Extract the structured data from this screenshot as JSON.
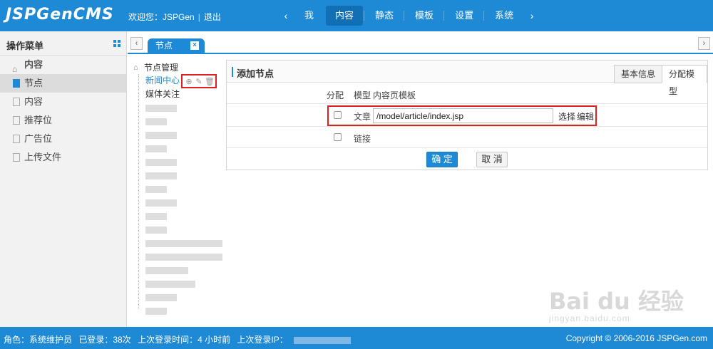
{
  "app": {
    "logo": "JSPGenCMS"
  },
  "header": {
    "welcome": "欢迎您：JSPGen",
    "logout": "退出",
    "nav_prev": "‹",
    "nav": [
      "我",
      "内容",
      "静态",
      "模板",
      "设置",
      "系统"
    ],
    "nav_active": "内容",
    "nav_next": "›"
  },
  "sidebar": {
    "title": "操作菜单",
    "group": "内容",
    "items": [
      "节点",
      "内容",
      "推荐位",
      "广告位",
      "上传文件"
    ],
    "selected": "节点"
  },
  "tabs": {
    "active": "节点",
    "close": "×",
    "scroll_left": "‹",
    "scroll_right": "›"
  },
  "tree": {
    "root": "节点管理",
    "nodes": [
      {
        "label": "新闻中心",
        "active": true
      },
      {
        "label": "媒体关注",
        "active": false
      }
    ],
    "actions": [
      "add-icon",
      "edit-icon",
      "delete-icon"
    ]
  },
  "panel": {
    "title": "添加节点",
    "tabs": [
      "基本信息",
      "分配模型"
    ],
    "active_tab": "分配模型",
    "columns": {
      "assign": "分配",
      "model": "模型",
      "template": "内容页模板"
    },
    "rows": [
      {
        "model": "文章",
        "template": "/model/article/index.jsp",
        "select": "选择",
        "edit": "编辑",
        "checked": false
      },
      {
        "model": "链接",
        "checked": false
      }
    ],
    "confirm": "确 定",
    "cancel": "取 消"
  },
  "footer": {
    "role": "角色：系统维护员",
    "logins": "已登录：38次",
    "last_time": "上次登录时间：4 小时前",
    "last_ip": "上次登录IP：",
    "copyright": "Copyright © 2006-2016 JSPGen.com"
  },
  "watermark": {
    "big": "Bai du 经验",
    "small": "jingyan.baidu.com"
  },
  "colors": {
    "primary": "#1e8ad6",
    "highlight": "#e02020"
  }
}
